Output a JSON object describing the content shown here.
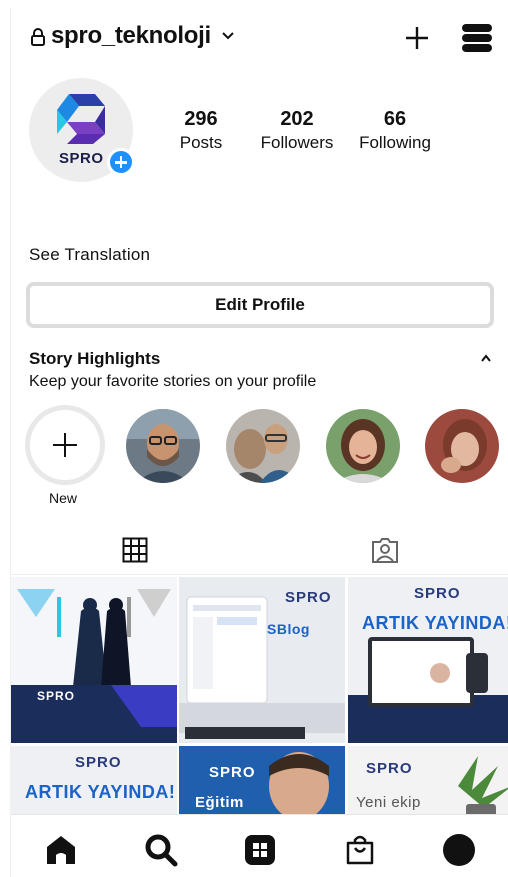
{
  "header": {
    "username": "spro_teknoloji"
  },
  "profile": {
    "avatar_text": "SPRO",
    "stats": [
      {
        "value": "296",
        "label": "Posts"
      },
      {
        "value": "202",
        "label": "Followers"
      },
      {
        "value": "66",
        "label": "Following"
      }
    ]
  },
  "see_translation": "See Translation",
  "edit_profile_label": "Edit Profile",
  "highlights": {
    "title": "Story Highlights",
    "subtitle": "Keep your favorite stories on your profile",
    "new_label": "New"
  },
  "posts": [
    {
      "brand": "SPRO",
      "headline": ""
    },
    {
      "brand": "SPRO",
      "headline": "SBlog"
    },
    {
      "brand": "SPRO",
      "headline": "ARTIK YAYINDA!"
    },
    {
      "brand": "SPRO",
      "headline": "ARTIK YAYINDA!"
    },
    {
      "brand": "SPRO",
      "headline": "Eğitim"
    },
    {
      "brand": "SPRO",
      "headline": "Yeni ekip"
    }
  ],
  "colors": {
    "accent_blue": "#1e90ff",
    "brand_navy": "#1b1f4a",
    "brand_blue": "#1b63c6"
  }
}
